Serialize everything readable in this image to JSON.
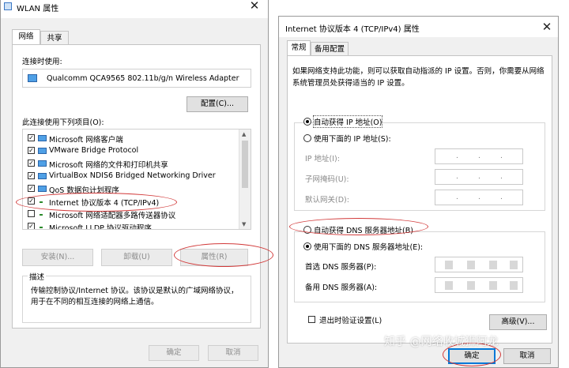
{
  "left": {
    "title": "WLAN 属性",
    "tab_network": "网络",
    "tab_sharing": "共享",
    "connect_using_label": "连接时使用:",
    "adapter_name": "Qualcomm QCA9565 802.11b/g/n Wireless Adapter",
    "configure_button": "配置(C)...",
    "items_label": "此连接使用下列项目(O):",
    "items": [
      {
        "label": "Microsoft 网络客户端",
        "checked": true,
        "icon": "network-client-icon"
      },
      {
        "label": "VMware Bridge Protocol",
        "checked": true,
        "icon": "network-protocol-icon"
      },
      {
        "label": "Microsoft 网络的文件和打印机共享",
        "checked": true,
        "icon": "file-share-icon"
      },
      {
        "label": "VirtualBox NDIS6 Bridged Networking Driver",
        "checked": true,
        "icon": "network-driver-icon"
      },
      {
        "label": "QoS 数据包计划程序",
        "checked": true,
        "icon": "qos-icon"
      },
      {
        "label": "Internet 协议版本 4 (TCP/IPv4)",
        "checked": true,
        "icon": "protocol-icon"
      },
      {
        "label": "Microsoft 网络适配器多路传送器协议",
        "checked": false,
        "icon": "protocol-icon"
      },
      {
        "label": "Microsoft LLDP 协议驱动程序",
        "checked": true,
        "icon": "protocol-icon"
      }
    ],
    "install_button": "安装(N)...",
    "uninstall_button": "卸载(U)",
    "properties_button": "属性(R)",
    "description_label": "描述",
    "description_text": "传输控制协议/Internet 协议。该协议是默认的广域网络协议，用于在不同的相互连接的网络上通信。",
    "ok_button": "确定",
    "cancel_button": "取消"
  },
  "right": {
    "title": "Internet 协议版本 4 (TCP/IPv4) 属性",
    "tab_general": "常规",
    "tab_alternate": "备用配置",
    "intro_text": "如果网络支持此功能，则可以获取自动指派的 IP 设置。否则，你需要从网络系统管理员处获得适当的 IP 设置。",
    "auto_ip": "自动获得 IP 地址(O)",
    "manual_ip": "使用下面的 IP 地址(S):",
    "ip_address_label": "IP 地址(I):",
    "subnet_label": "子网掩码(U):",
    "gateway_label": "默认网关(D):",
    "auto_dns": "自动获得 DNS 服务器地址(B)",
    "manual_dns": "使用下面的 DNS 服务器地址(E):",
    "preferred_dns_label": "首选 DNS 服务器(P):",
    "alternate_dns_label": "备用 DNS 服务器(A):",
    "validate_label": "退出时验证设置(L)",
    "advanced_button": "高级(V)...",
    "ok_button": "确定",
    "cancel_button": "取消"
  },
  "watermark": "知乎 @网络收城狮阿龙",
  "colors": {
    "annotation": "#d23a3a",
    "focus": "#0078d7",
    "window_bg": "#f0f0f0"
  }
}
